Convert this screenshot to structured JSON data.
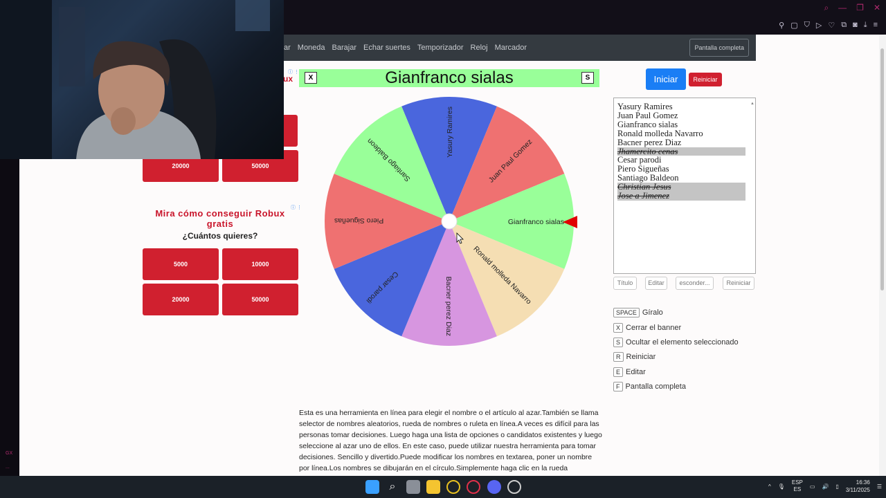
{
  "nav": {
    "links": [
      "ar",
      "Moneda",
      "Barajar",
      "Echar suertes",
      "Temporizador",
      "Reloj",
      "Marcador"
    ],
    "fullscreen": "Pantalla completa"
  },
  "ads": {
    "ad1_logo": "ux",
    "ad1_buttons": [
      "20000",
      "50000"
    ],
    "ad2_title": "Mira cómo conseguir Robux gratis",
    "ad2_subtitle": "¿Cuántos quieres?",
    "ad2_buttons": [
      "5000",
      "10000",
      "20000",
      "50000"
    ],
    "info_icon": "ⓘ ⋮"
  },
  "banner": {
    "close_key": "X",
    "title": "Gianfranco sialas",
    "hide_key": "S"
  },
  "wheel": {
    "segments": [
      {
        "label": "Yasury Ramires",
        "color": "#4a66dd"
      },
      {
        "label": "Juan Paul Gomez",
        "color": "#ef7171"
      },
      {
        "label": "Gianfranco sialas",
        "color": "#99ff99"
      },
      {
        "label": "Ronald molleda Navarro",
        "color": "#f5deb3"
      },
      {
        "label": "Bacner perez Diaz",
        "color": "#d796e0"
      },
      {
        "label": "Cesar parodi",
        "color": "#4a66dd"
      },
      {
        "label": "Piero Sigueñas",
        "color": "#ef7171"
      },
      {
        "label": "Santiago Baldeon",
        "color": "#99ff99"
      }
    ],
    "pointer_color": "#e00000"
  },
  "controls": {
    "start": "Iniciar",
    "reset": "Reiniciar"
  },
  "names": [
    {
      "text": "Yasury Ramires",
      "hidden": false
    },
    {
      "text": "Juan Paul Gomez",
      "hidden": false
    },
    {
      "text": "Gianfranco sialas",
      "hidden": false
    },
    {
      "text": "Ronald molleda Navarro",
      "hidden": false
    },
    {
      "text": "Bacner perez Diaz",
      "hidden": false
    },
    {
      "text": "Jhamercito cenas",
      "hidden": true
    },
    {
      "text": "Cesar parodi",
      "hidden": false
    },
    {
      "text": "Piero Sigueñas",
      "hidden": false
    },
    {
      "text": "Santiago Baldeon",
      "hidden": false
    },
    {
      "text": "Christian Jesus",
      "hidden": true
    },
    {
      "text": "Jose a Jimenez",
      "hidden": true
    }
  ],
  "list_buttons": [
    "Título",
    "Editar",
    "esconder...",
    "Reiniciar"
  ],
  "shortcuts": [
    {
      "key": "SPACE",
      "label": "Gíralo"
    },
    {
      "key": "X",
      "label": "Cerrar el banner"
    },
    {
      "key": "S",
      "label": "Ocultar el elemento seleccionado"
    },
    {
      "key": "R",
      "label": "Reiniciar"
    },
    {
      "key": "E",
      "label": "Editar"
    },
    {
      "key": "F",
      "label": "Pantalla completa"
    }
  ],
  "description": "Esta es una herramienta en línea para elegir el nombre o el artículo al azar.También se llama selector de nombres aleatorios, rueda de nombres o ruleta en línea.A veces es difícil para las personas tomar decisiones. Luego haga una lista de opciones o candidatos existentes y luego seleccione al azar uno de ellos. En este caso, puede utilizar nuestra herramienta para tomar decisiones. Sencillo y divertido.Puede modificar los nombres en textarea, poner un nombre por línea.Los nombres se dibujarán en el círculo.Simplemente haga clic en la rueda",
  "browser": {
    "rail_text_1": "GX",
    "rail_text_2": "..."
  },
  "tray": {
    "lang1": "ESP",
    "lang2": "ES",
    "time": "16:36",
    "date": "3/11/2025"
  }
}
